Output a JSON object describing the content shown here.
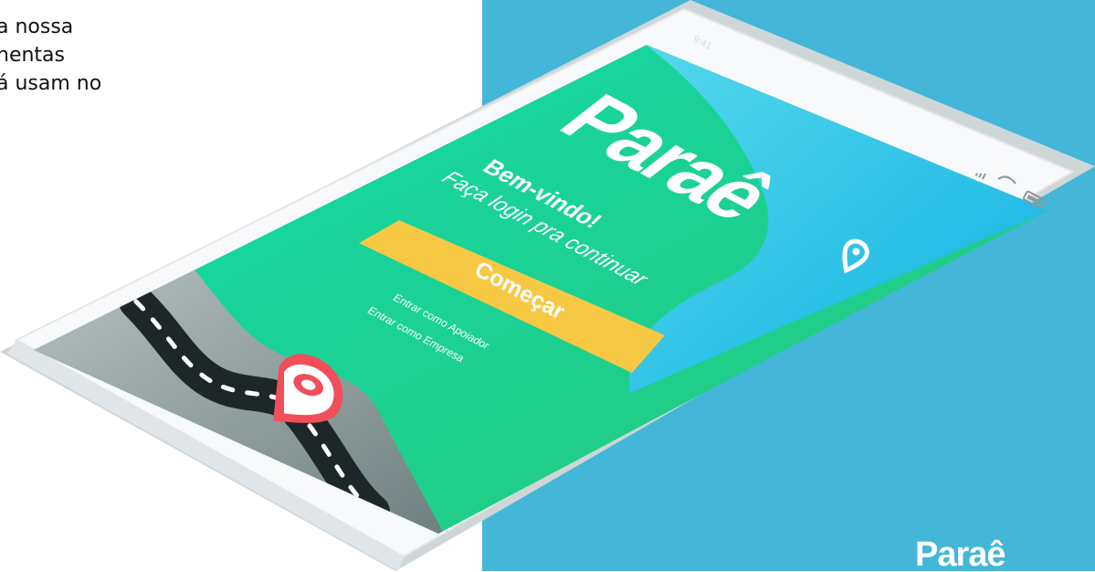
{
  "left_text": {
    "line_1": "a nossa",
    "line_2": "nentas",
    "line_3": "á usam no"
  },
  "phone": {
    "time": "9:41",
    "brand": "Paraê",
    "welcome_title": "Bem-vindo!",
    "welcome_subtitle": "Faça login pra continuar",
    "start_button": "Começar",
    "link_supporter": "Entrar como Apoiador",
    "link_company": "Entrar como Empresa"
  },
  "corner_logo": {
    "text": "Paraê"
  },
  "colors": {
    "panel_blue": "#44b7d9",
    "green": "#21d6a5",
    "blue": "#22bde0",
    "yellow": "#f7c843",
    "pin_red": "#f04e5a"
  },
  "icons": {
    "signal": "signal-icon",
    "wifi": "wifi-icon",
    "battery": "battery-icon",
    "location": "location-pin-icon"
  }
}
